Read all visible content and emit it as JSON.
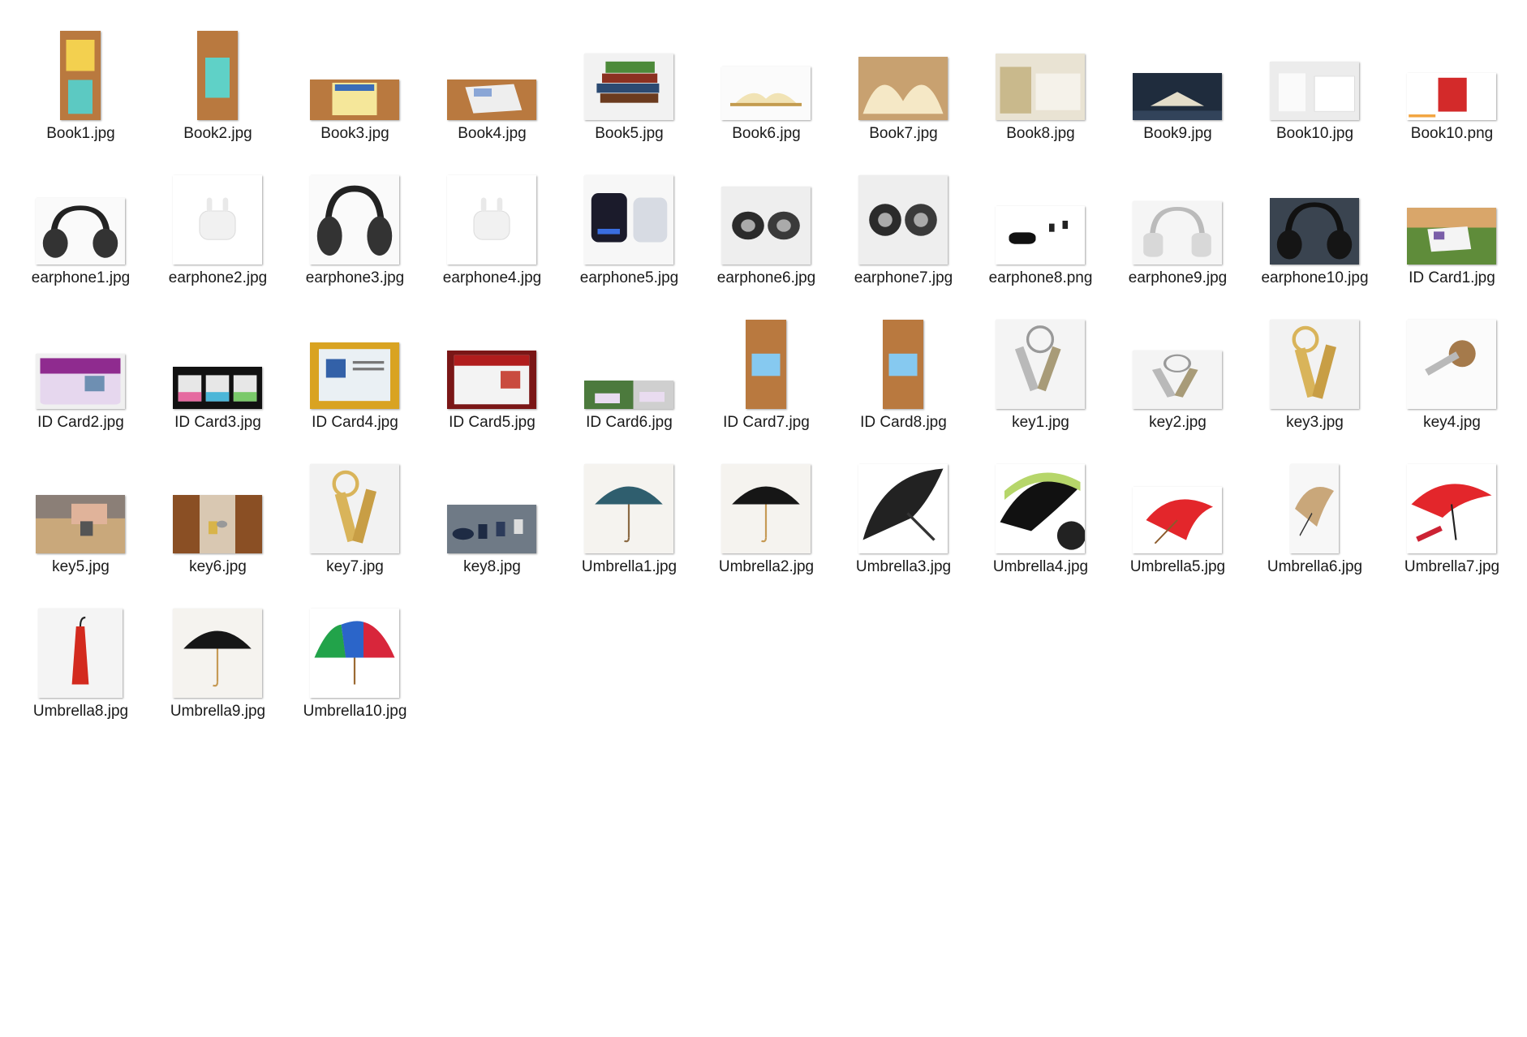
{
  "files": [
    {
      "name": "Book1.jpg",
      "icon": "book-photo-icon"
    },
    {
      "name": "Book2.jpg",
      "icon": "book-photo-icon"
    },
    {
      "name": "Book3.jpg",
      "icon": "book-photo-icon"
    },
    {
      "name": "Book4.jpg",
      "icon": "book-photo-icon"
    },
    {
      "name": "Book5.jpg",
      "icon": "book-photo-icon"
    },
    {
      "name": "Book6.jpg",
      "icon": "book-photo-icon"
    },
    {
      "name": "Book7.jpg",
      "icon": "book-photo-icon"
    },
    {
      "name": "Book8.jpg",
      "icon": "book-photo-icon"
    },
    {
      "name": "Book9.jpg",
      "icon": "book-photo-icon"
    },
    {
      "name": "Book10.jpg",
      "icon": "book-photo-icon"
    },
    {
      "name": "Book10.png",
      "icon": "book-photo-icon"
    },
    {
      "name": "earphone1.jpg",
      "icon": "headphones-photo-icon"
    },
    {
      "name": "earphone2.jpg",
      "icon": "earbuds-photo-icon"
    },
    {
      "name": "earphone3.jpg",
      "icon": "headphones-photo-icon"
    },
    {
      "name": "earphone4.jpg",
      "icon": "earbuds-photo-icon"
    },
    {
      "name": "earphone5.jpg",
      "icon": "earbuds-photo-icon"
    },
    {
      "name": "earphone6.jpg",
      "icon": "earbuds-photo-icon"
    },
    {
      "name": "earphone7.jpg",
      "icon": "earbuds-photo-icon"
    },
    {
      "name": "earphone8.png",
      "icon": "earbuds-photo-icon"
    },
    {
      "name": "earphone9.jpg",
      "icon": "headphones-photo-icon"
    },
    {
      "name": "earphone10.jpg",
      "icon": "headphones-photo-icon"
    },
    {
      "name": "ID Card1.jpg",
      "icon": "id-card-photo-icon"
    },
    {
      "name": "ID Card2.jpg",
      "icon": "id-card-photo-icon"
    },
    {
      "name": "ID Card3.jpg",
      "icon": "id-card-photo-icon"
    },
    {
      "name": "ID Card4.jpg",
      "icon": "id-card-photo-icon"
    },
    {
      "name": "ID Card5.jpg",
      "icon": "id-card-photo-icon"
    },
    {
      "name": "ID Card6.jpg",
      "icon": "id-card-photo-icon"
    },
    {
      "name": "ID Card7.jpg",
      "icon": "id-card-photo-icon"
    },
    {
      "name": "ID Card8.jpg",
      "icon": "id-card-photo-icon"
    },
    {
      "name": "key1.jpg",
      "icon": "key-photo-icon"
    },
    {
      "name": "key2.jpg",
      "icon": "key-photo-icon"
    },
    {
      "name": "key3.jpg",
      "icon": "key-photo-icon"
    },
    {
      "name": "key4.jpg",
      "icon": "key-photo-icon"
    },
    {
      "name": "key5.jpg",
      "icon": "key-photo-icon"
    },
    {
      "name": "key6.jpg",
      "icon": "key-photo-icon"
    },
    {
      "name": "key7.jpg",
      "icon": "key-photo-icon"
    },
    {
      "name": "key8.jpg",
      "icon": "key-photo-icon"
    },
    {
      "name": "Umbrella1.jpg",
      "icon": "umbrella-photo-icon"
    },
    {
      "name": "Umbrella2.jpg",
      "icon": "umbrella-photo-icon"
    },
    {
      "name": "Umbrella3.jpg",
      "icon": "umbrella-photo-icon"
    },
    {
      "name": "Umbrella4.jpg",
      "icon": "umbrella-photo-icon"
    },
    {
      "name": "Umbrella5.jpg",
      "icon": "umbrella-photo-icon"
    },
    {
      "name": "Umbrella6.jpg",
      "icon": "umbrella-photo-icon"
    },
    {
      "name": "Umbrella7.jpg",
      "icon": "umbrella-photo-icon"
    },
    {
      "name": "Umbrella8.jpg",
      "icon": "umbrella-photo-icon"
    },
    {
      "name": "Umbrella9.jpg",
      "icon": "umbrella-photo-icon"
    },
    {
      "name": "Umbrella10.jpg",
      "icon": "umbrella-photo-icon"
    }
  ],
  "colors": {
    "background": "#ffffff",
    "label": "#1a1a1a",
    "wood": "#b9793f",
    "umbrella_red": "#e3262b",
    "umbrella_teal": "#2f5e6e",
    "metal_gold": "#d9b45a",
    "metal_silver": "#b9b9b9"
  }
}
